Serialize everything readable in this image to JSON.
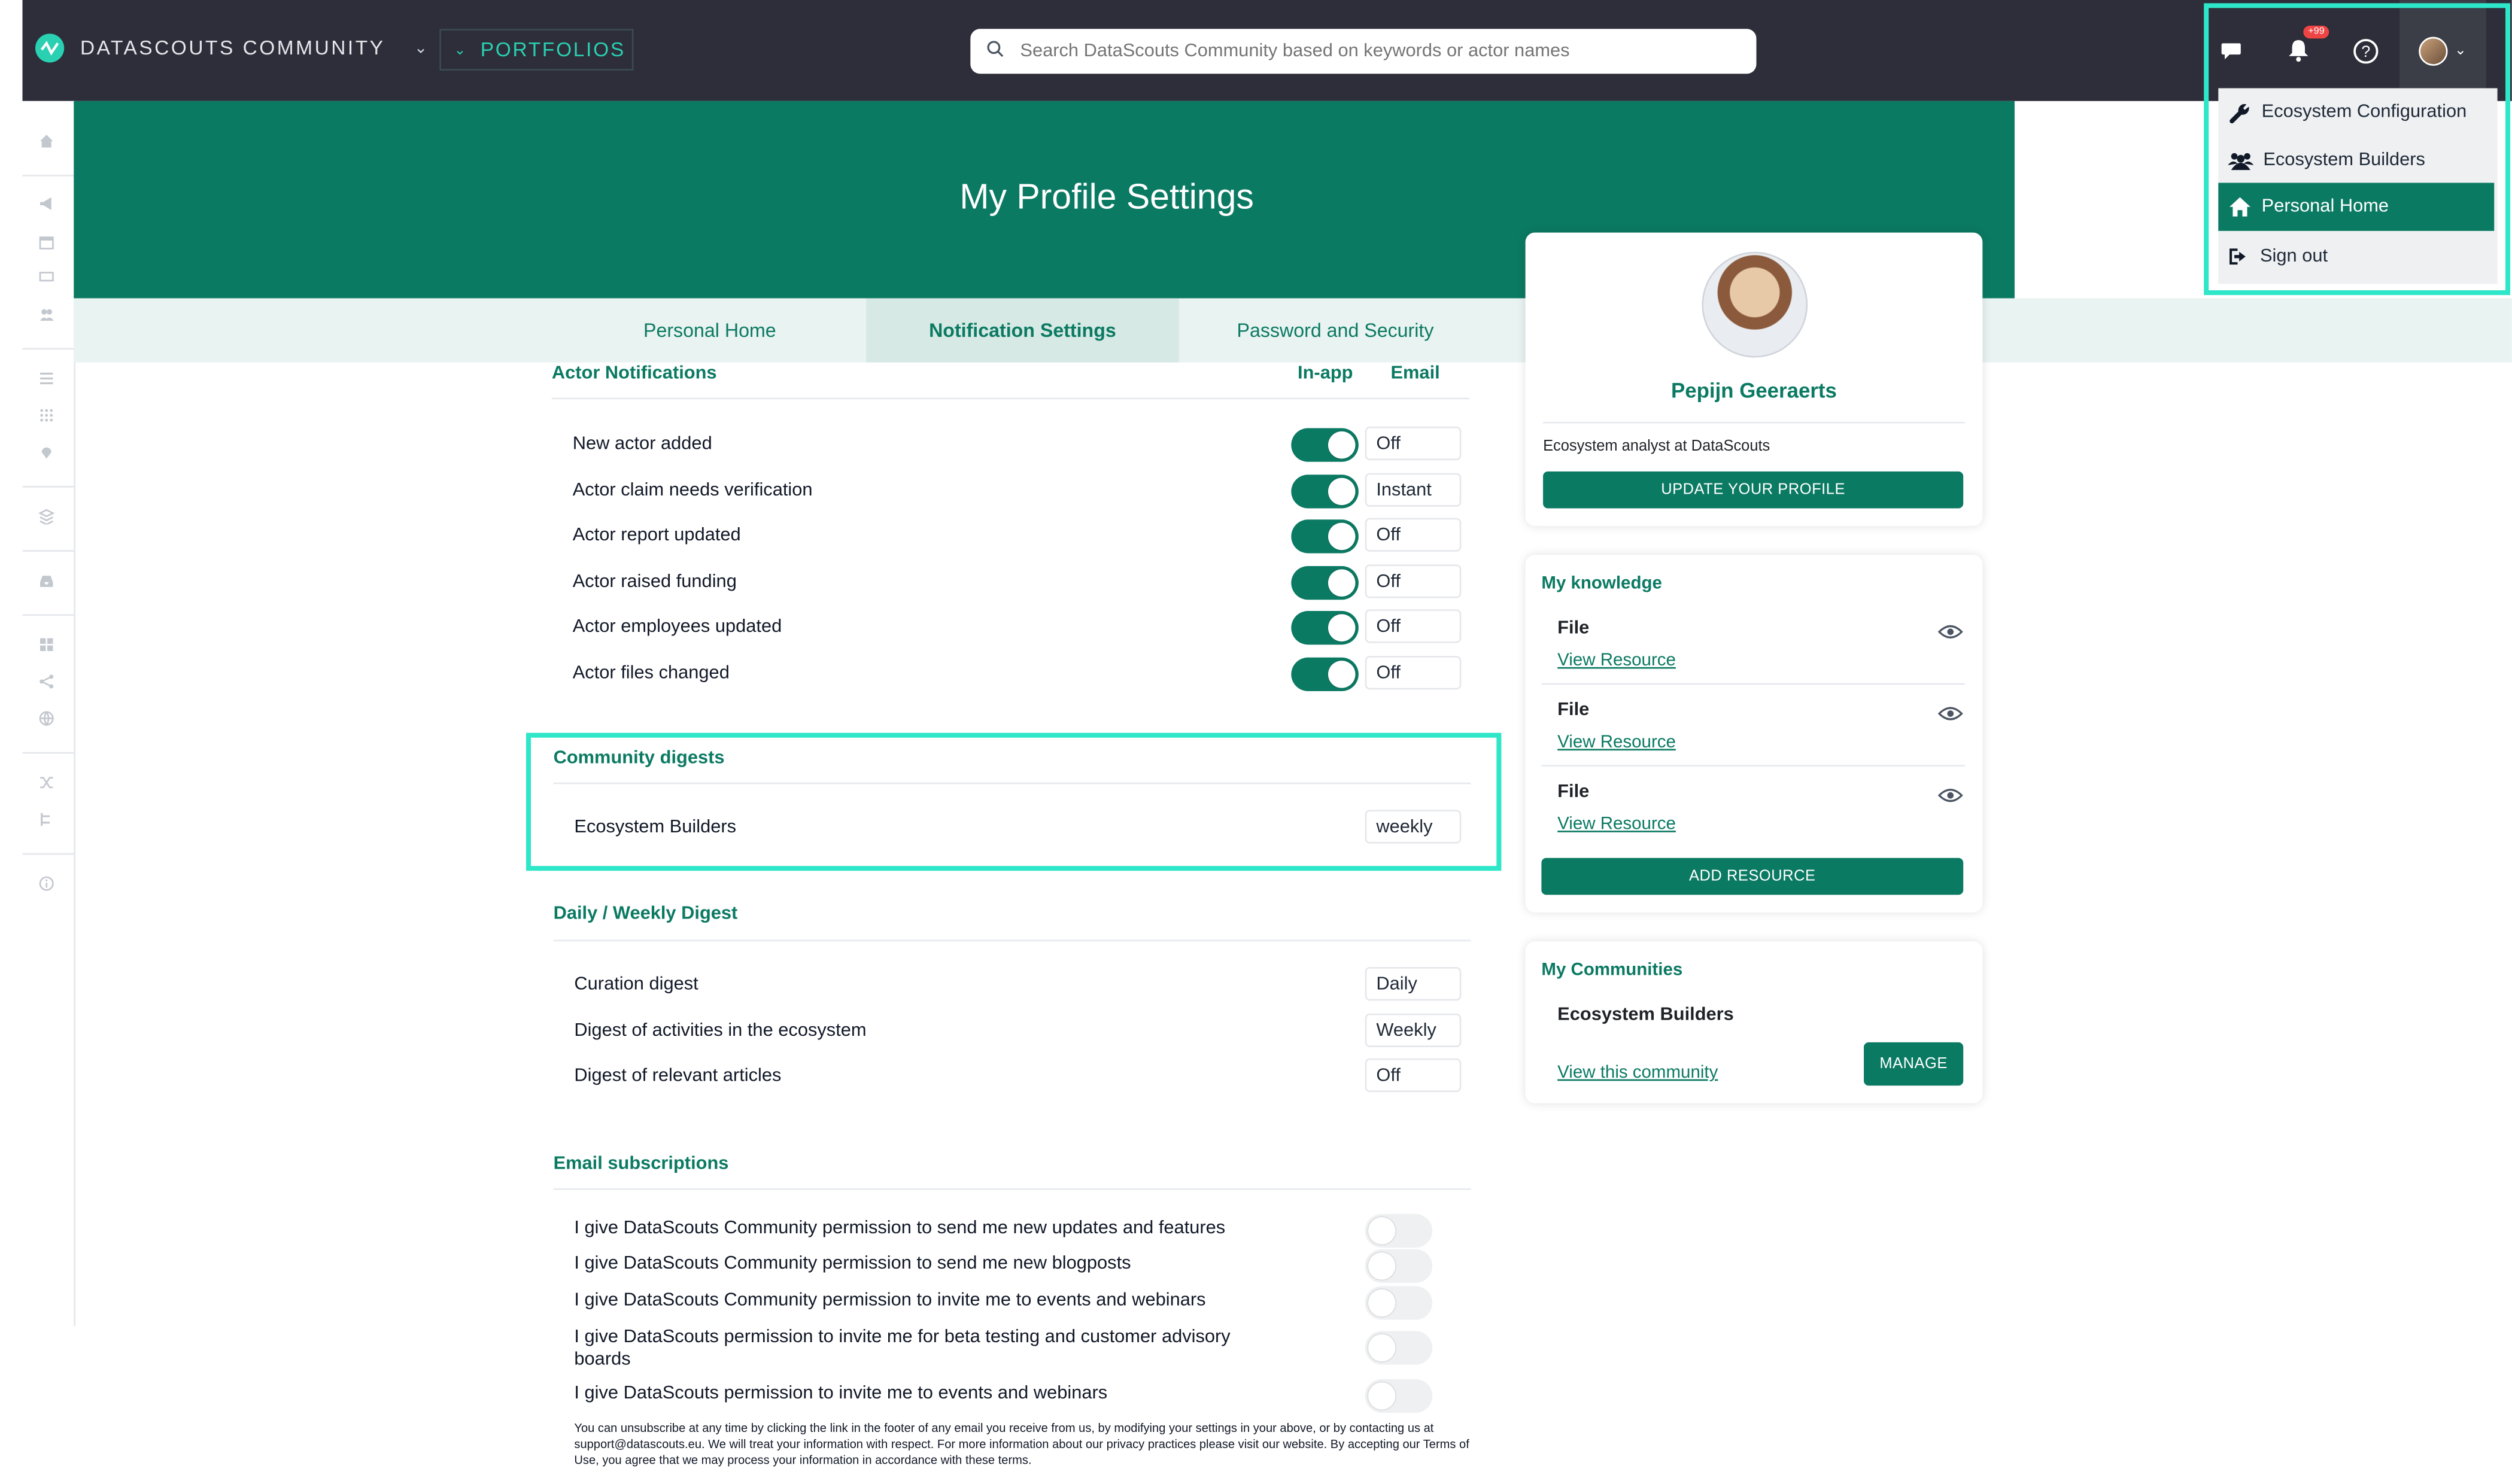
{
  "app": {
    "name": "DATASCOUTS COMMUNITY",
    "portfolios": "PORTFOLIOS"
  },
  "search": {
    "placeholder": "Search DataScouts Community based on keywords or actor names"
  },
  "header": {
    "notifications_badge": "+99"
  },
  "page": {
    "title": "My Profile Settings"
  },
  "tabs": [
    {
      "label": "Personal Home"
    },
    {
      "label": "Notification Settings",
      "active": true
    },
    {
      "label": "Password and Security"
    }
  ],
  "actor_notifications": {
    "title": "Actor Notifications",
    "col_inapp": "In-app",
    "col_email": "Email",
    "rows": [
      {
        "label": "New actor added",
        "inapp": true,
        "email": "Off"
      },
      {
        "label": "Actor claim needs verification",
        "inapp": true,
        "email": "Instant"
      },
      {
        "label": "Actor report updated",
        "inapp": true,
        "email": "Off"
      },
      {
        "label": "Actor raised funding",
        "inapp": true,
        "email": "Off"
      },
      {
        "label": "Actor employees updated",
        "inapp": true,
        "email": "Off"
      },
      {
        "label": "Actor files changed",
        "inapp": true,
        "email": "Off"
      }
    ]
  },
  "community_digests": {
    "title": "Community digests",
    "rows": [
      {
        "label": "Ecosystem Builders",
        "value": "weekly"
      }
    ]
  },
  "daily_weekly": {
    "title": "Daily / Weekly Digest",
    "rows": [
      {
        "label": "Curation digest",
        "value": "Daily"
      },
      {
        "label": "Digest of activities in the ecosystem",
        "value": "Weekly"
      },
      {
        "label": "Digest of relevant articles",
        "value": "Off"
      }
    ]
  },
  "email_subscriptions": {
    "title": "Email subscriptions",
    "rows": [
      {
        "label": "I give DataScouts Community permission to send me new updates and features",
        "on": false
      },
      {
        "label": "I give DataScouts Community permission to send me new blogposts",
        "on": false
      },
      {
        "label": "I give DataScouts Community permission to invite me to events and webinars",
        "on": false
      },
      {
        "label": "I give DataScouts permission to invite me for beta testing and customer advisory boards",
        "on": false
      },
      {
        "label": "I give DataScouts permission to invite me to events and webinars",
        "on": false
      }
    ],
    "fine_print": "You can unsubscribe at any time by clicking the link in the footer of any email you receive from us, by modifying your settings in your above, or by contacting us at support@datascouts.eu. We will treat your information with respect. For more information about our privacy practices please visit our website. By accepting our Terms of Use, you agree that we may process your information in accordance with these terms."
  },
  "profile": {
    "name": "Pepijn Geeraerts",
    "role": "Ecosystem analyst at DataScouts",
    "update_button": "UPDATE YOUR PROFILE"
  },
  "knowledge": {
    "title": "My knowledge",
    "items": [
      {
        "title": "File",
        "link": "View Resource"
      },
      {
        "title": "File",
        "link": "View Resource"
      },
      {
        "title": "File",
        "link": "View Resource"
      }
    ],
    "add_button": "ADD RESOURCE"
  },
  "communities": {
    "title": "My Communities",
    "name": "Ecosystem Builders",
    "link": "View this community",
    "manage_button": "MANAGE"
  },
  "user_menu": {
    "items": [
      {
        "label": "Ecosystem Configuration",
        "icon": "wrench-icon"
      },
      {
        "label": "Ecosystem Builders",
        "icon": "users-icon"
      },
      {
        "label": "Personal Home",
        "icon": "home-icon",
        "active": true
      },
      {
        "label": "Sign out",
        "icon": "sign-out-icon"
      }
    ]
  },
  "colors": {
    "accent": "#0b7a63",
    "highlight": "#2ee6c8",
    "topbar": "#2d2e39"
  }
}
